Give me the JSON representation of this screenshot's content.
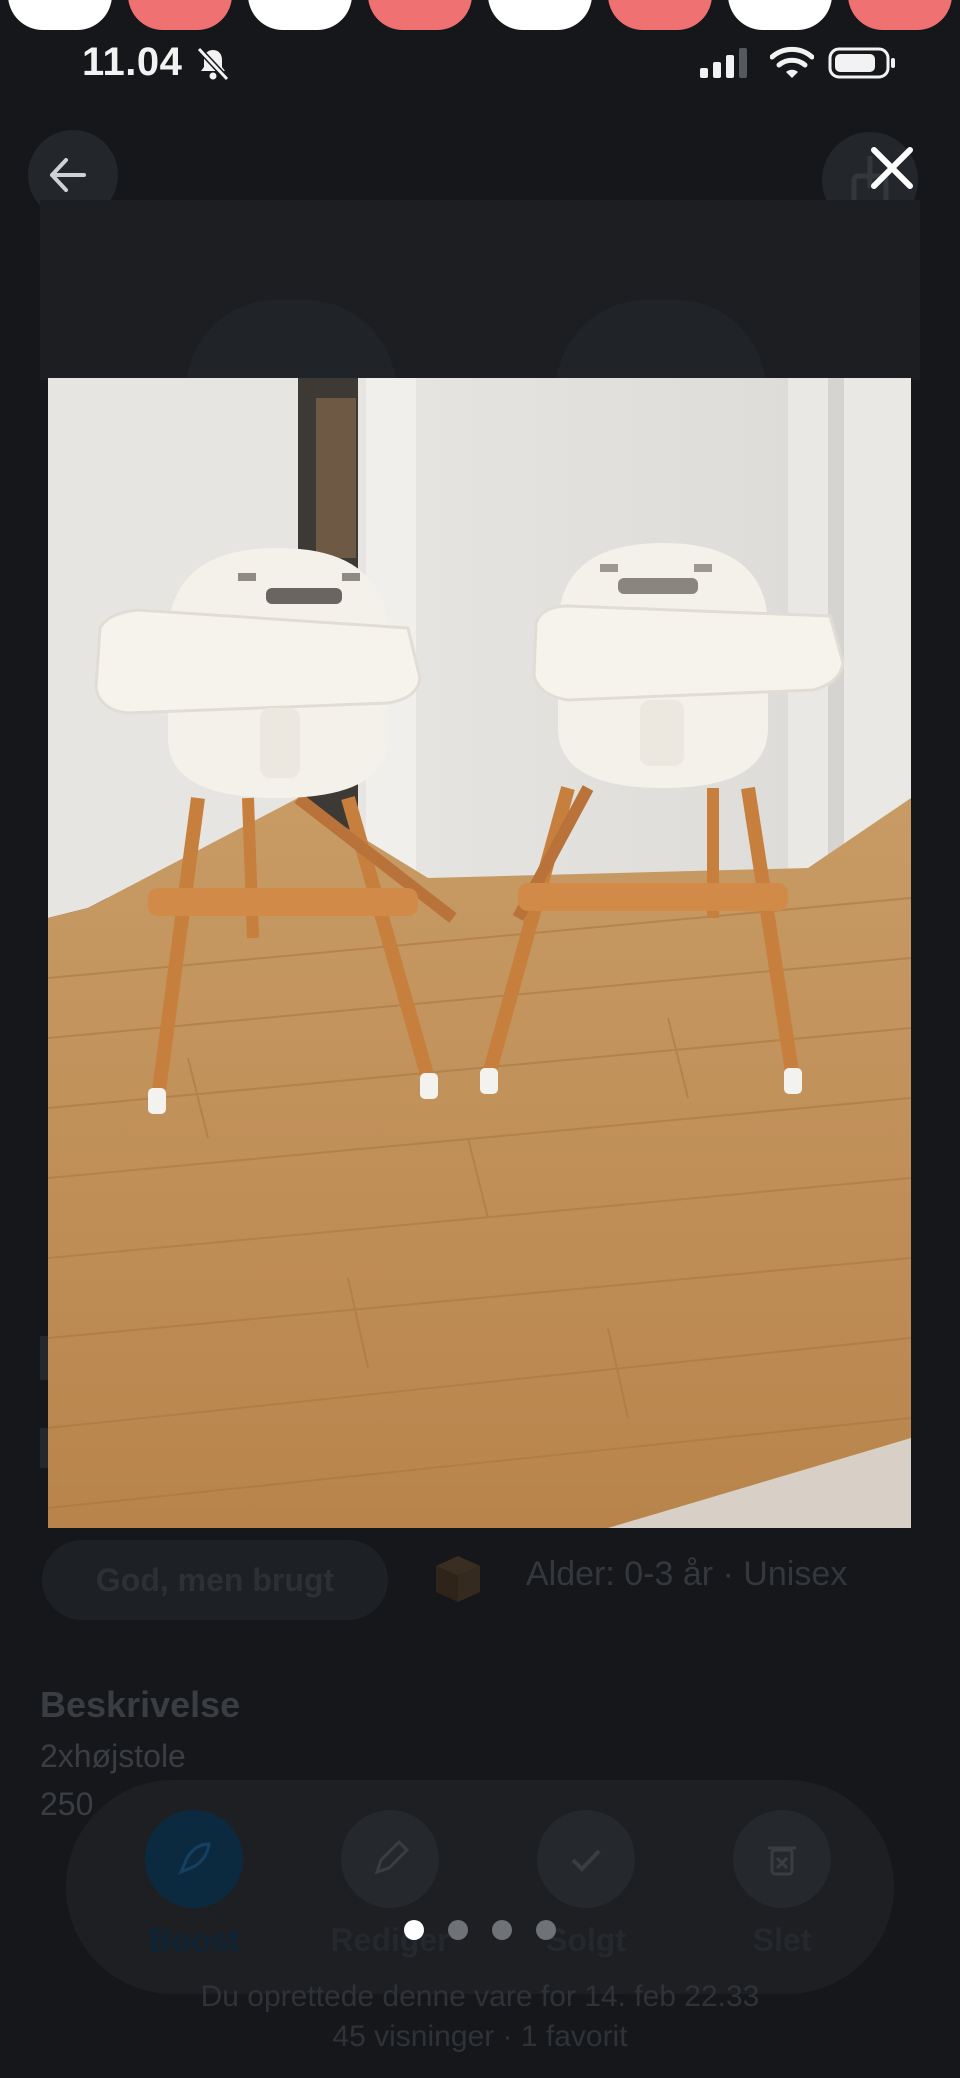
{
  "status_bar": {
    "time": "11.04"
  },
  "background_listing": {
    "condition": "God, men brugt",
    "attributes": "Alder: 0-3 år · Unisex",
    "description_title": "Beskrivelse",
    "description_lines": [
      "2xhøjstole",
      "250"
    ],
    "actions": [
      {
        "label": "Boost",
        "icon": "rocket-icon"
      },
      {
        "label": "Rediger",
        "icon": "pencil-icon"
      },
      {
        "label": "Solgt",
        "icon": "check-icon"
      },
      {
        "label": "Slet",
        "icon": "trash-icon"
      }
    ],
    "footer_created": "Du oprettede denne vare for 14. feb 22.33",
    "footer_stats": "45 visninger · 1 favorit"
  },
  "gallery": {
    "total_images": 4,
    "current_index": 1,
    "photo_description_icon": "photo-two-high-chairs"
  },
  "colors": {
    "background": "#15171a",
    "boost_accent": "#0c2a3f",
    "top_circle_red": "#f07171",
    "top_circle_white": "#ffffff"
  }
}
